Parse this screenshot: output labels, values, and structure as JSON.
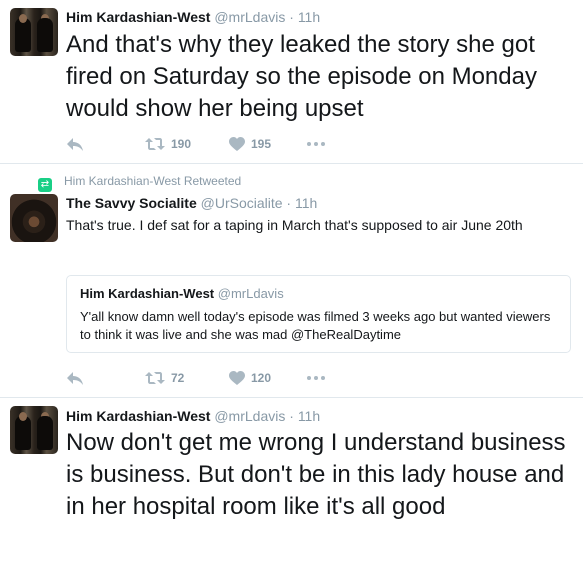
{
  "tweets": [
    {
      "name": "Him Kardashian-West",
      "handle": "@mrLdavis",
      "sep": "·",
      "time": "11h",
      "text": "And that's why they leaked the story she got fired on Saturday so the episode on Monday would show her being upset",
      "retweets": "190",
      "likes": "195"
    },
    {
      "retweeted_by": "Him Kardashian-West Retweeted",
      "name": "The Savvy Socialite",
      "handle": "@UrSocialite",
      "sep": "·",
      "time": "11h",
      "text": "That's true. I def sat for a taping in March that's supposed to air June 20th",
      "quote": {
        "name": "Him Kardashian-West",
        "handle": "@mrLdavis",
        "text": "Y'all know damn well today's episode was filmed 3 weeks ago but wanted viewers to think it was live and she was mad @TheRealDaytime"
      },
      "retweets": "72",
      "likes": "120"
    },
    {
      "name": "Him Kardashian-West",
      "handle": "@mrLdavis",
      "sep": "·",
      "time": "11h",
      "text": "Now don't get me wrong I understand business is business. But don't be in this lady house and in her hospital room like it's all good"
    }
  ],
  "icons": {
    "reply": "reply-icon",
    "retweet": "retweet-icon",
    "like": "heart-icon",
    "more": "more-icon"
  },
  "colors": {
    "text": "#14171a",
    "muted": "#8899a6",
    "retweet_badge": "#19cf86",
    "border": "#e1e8ed"
  }
}
